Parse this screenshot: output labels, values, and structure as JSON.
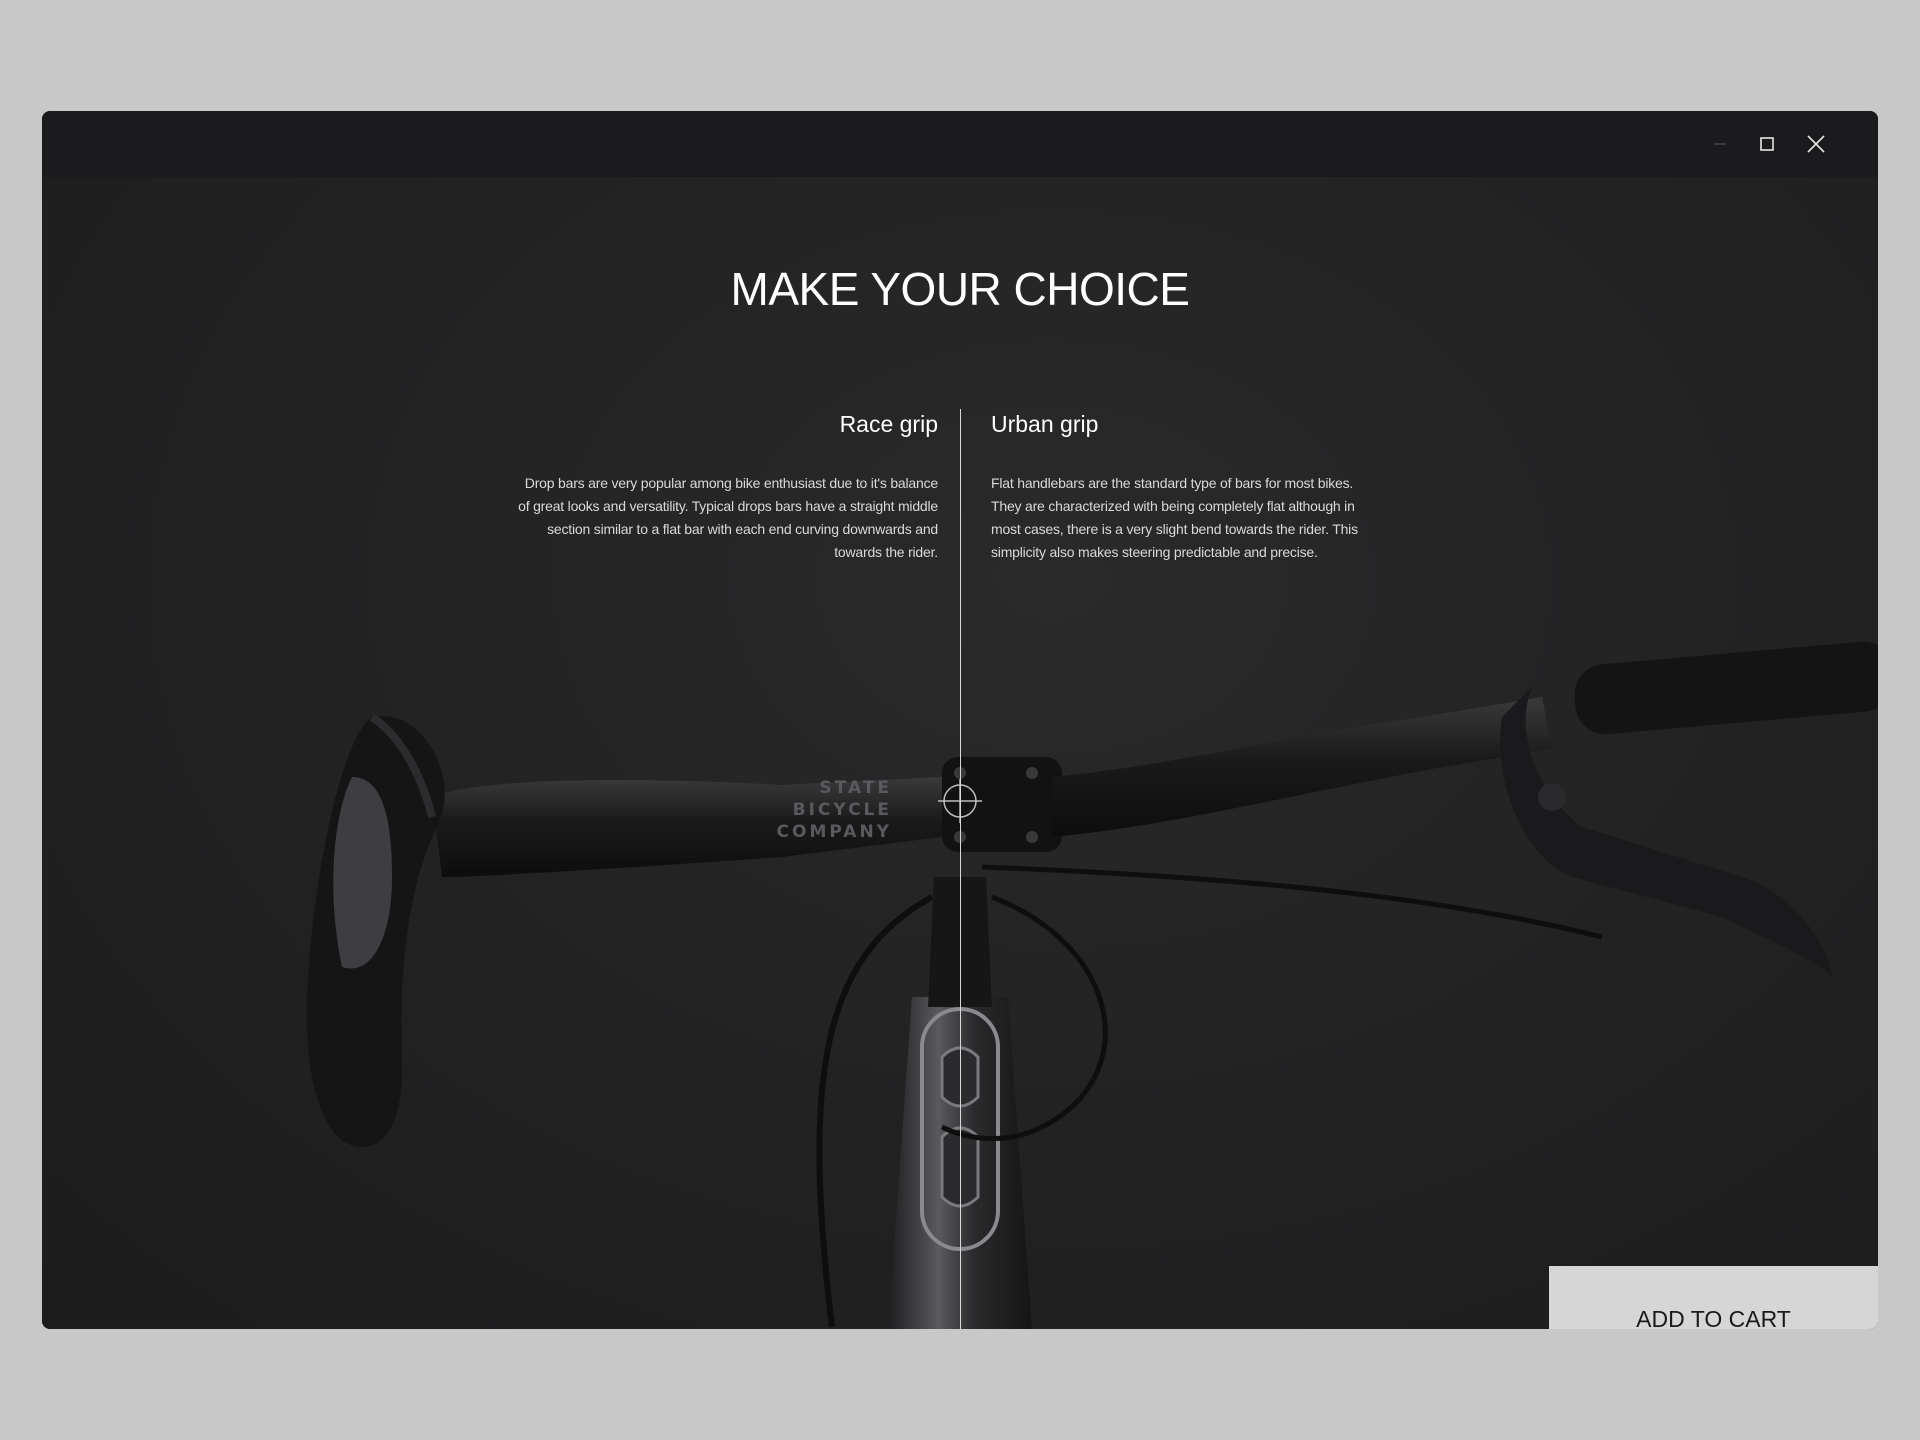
{
  "window": {
    "controls": {
      "minimize_icon": "minimize-icon",
      "maximize_icon": "maximize-icon",
      "close_icon": "close-icon"
    }
  },
  "main": {
    "title": "MAKE YOUR CHOICE",
    "options": [
      {
        "title": "Race grip",
        "description": "Drop bars are very popular among bike enthusiast due to it's balance of great looks and versatility. Typical drops bars have a straight middle section similar to a flat bar with each end curving downwards and towards the rider."
      },
      {
        "title": "Urban grip",
        "description": "Flat handlebars are the standard type of bars for most bikes. They are characterized with being completely flat although in most cases, there is a very slight bend towards the rider. This simplicity also makes steering predictable and precise."
      }
    ],
    "bike_logo": [
      "STATE",
      "BICYCLE",
      "COMPANY"
    ]
  },
  "cart": {
    "label": "ADD TO CART"
  },
  "colors": {
    "page_bg": "#c8c8c8",
    "window_bg": "#1f1f20",
    "titlebar_bg": "#1b1b1d",
    "button_bg": "#d6d6d6",
    "text_primary": "#ffffff"
  }
}
